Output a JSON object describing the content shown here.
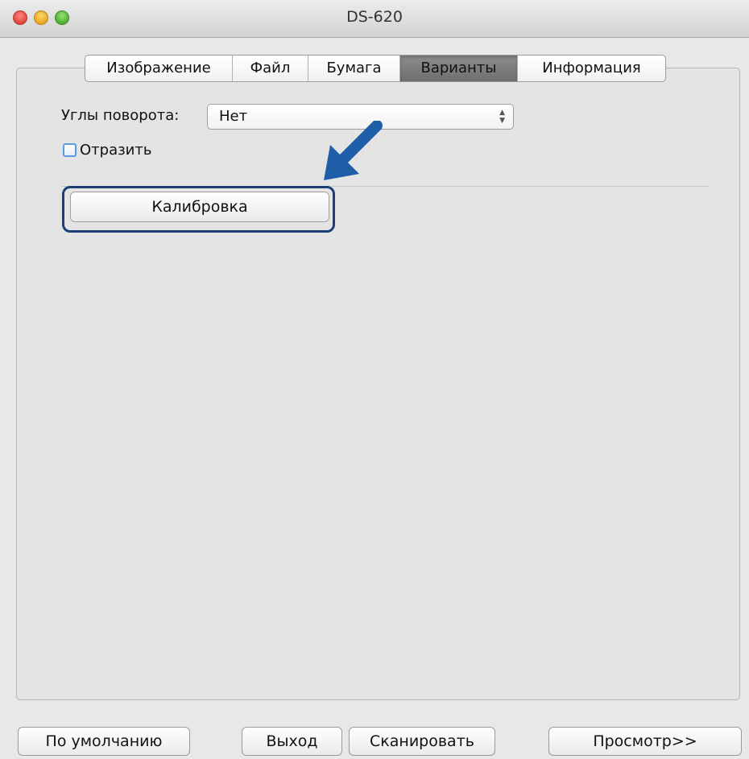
{
  "window": {
    "title": "DS-620"
  },
  "tabs": [
    {
      "label": "Изображение",
      "active": false
    },
    {
      "label": "Файл",
      "active": false
    },
    {
      "label": "Бумага",
      "active": false
    },
    {
      "label": "Варианты",
      "active": true
    },
    {
      "label": "Информация",
      "active": false
    }
  ],
  "options": {
    "rotation_label": "Углы поворота:",
    "rotation_value": "Нет",
    "mirror_label": "Отразить",
    "mirror_checked": false,
    "calibration_button": "Калибровка"
  },
  "footer": {
    "defaults_button": "По умолчанию",
    "exit_button": "Выход",
    "scan_button": "Сканировать",
    "preview_button": "Просмотр>>"
  },
  "colors": {
    "highlight": "#1d3f78",
    "arrow": "#1f5fa8",
    "active_tab": "#7a7a7a"
  }
}
